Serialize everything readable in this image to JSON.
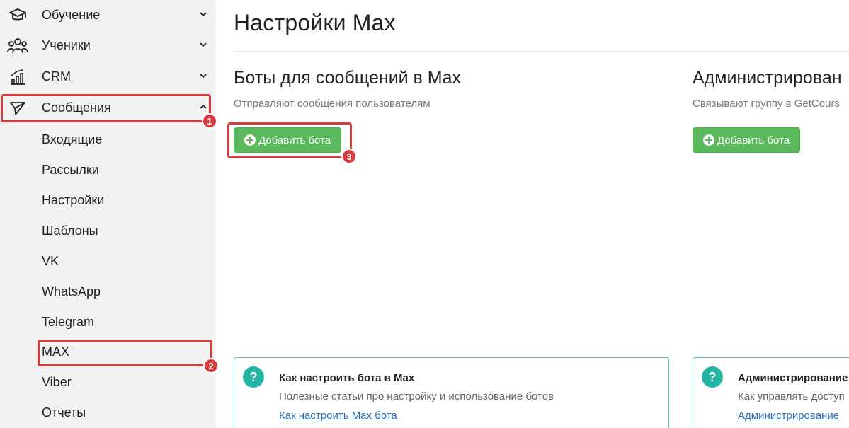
{
  "sidebar": {
    "main_items": [
      {
        "label": "Обучение",
        "icon": "graduation-cap-icon"
      },
      {
        "label": "Ученики",
        "icon": "users-icon"
      },
      {
        "label": "CRM",
        "icon": "chart-bars-icon"
      },
      {
        "label": "Сообщения",
        "icon": "paper-plane-icon"
      }
    ],
    "sub_items": [
      {
        "label": "Входящие"
      },
      {
        "label": "Рассылки"
      },
      {
        "label": "Настройки"
      },
      {
        "label": "Шаблоны"
      },
      {
        "label": "VK"
      },
      {
        "label": "WhatsApp"
      },
      {
        "label": "Telegram"
      },
      {
        "label": "MAX"
      },
      {
        "label": "Viber"
      },
      {
        "label": "Отчеты"
      }
    ]
  },
  "main": {
    "title": "Настройки Max",
    "left_col": {
      "title": "Боты для сообщений в Max",
      "subtitle": "Отправляют сообщения пользователям",
      "button": "Добавить бота"
    },
    "right_col": {
      "title": "Администрирован",
      "subtitle": "Связывают группу в GetCours",
      "button": "Добавить бота"
    },
    "help_left": {
      "icon": "?",
      "title": "Как настроить бота в Max",
      "text": "Полезные статьи про настройку и использование ботов",
      "link": "Как настроить Max бота"
    },
    "help_right": {
      "icon": "?",
      "title": "Администрирование",
      "text": "Как управлять доступ",
      "link": "Администрирование"
    }
  },
  "annotations": [
    "1",
    "2",
    "3"
  ],
  "colors": {
    "accent_green": "#5cb85c",
    "annotation_red": "#d93a3a",
    "help_teal": "#26b5a5",
    "sidebar_bg": "#f2f2f2"
  }
}
